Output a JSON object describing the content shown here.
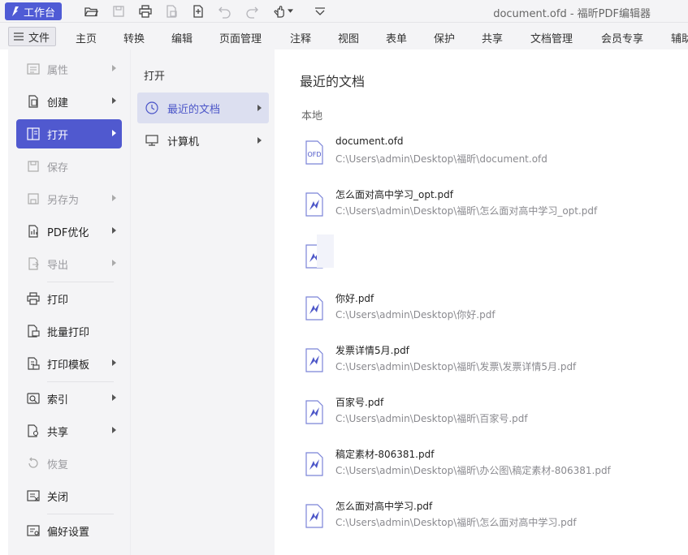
{
  "titlebar": {
    "app_label": "工作台",
    "window_title": "document.ofd - 福昕PDF编辑器"
  },
  "menubar": {
    "file_label": "文件",
    "tabs": [
      "主页",
      "转换",
      "编辑",
      "页面管理",
      "注释",
      "视图",
      "表单",
      "保护",
      "共享",
      "文档管理",
      "会员专享",
      "辅助"
    ]
  },
  "left_menu": {
    "items": [
      {
        "label": "属性",
        "state": "disabled",
        "icon": "properties-icon",
        "has_arrow": true
      },
      {
        "label": "创建",
        "state": "normal",
        "icon": "create-icon",
        "has_arrow": true
      },
      {
        "label": "打开",
        "state": "active",
        "icon": "open-icon",
        "has_arrow": true
      },
      {
        "label": "保存",
        "state": "disabled",
        "icon": "save-icon",
        "has_arrow": false
      },
      {
        "label": "另存为",
        "state": "disabled",
        "icon": "save-as-icon",
        "has_arrow": true
      },
      {
        "label": "PDF优化",
        "state": "normal",
        "icon": "pdf-optimize-icon",
        "has_arrow": true
      },
      {
        "label": "导出",
        "state": "disabled",
        "icon": "export-icon",
        "has_arrow": true
      },
      {
        "label": "打印",
        "state": "normal",
        "icon": "print-icon",
        "has_arrow": false
      },
      {
        "label": "批量打印",
        "state": "normal",
        "icon": "batch-print-icon",
        "has_arrow": false
      },
      {
        "label": "打印模板",
        "state": "normal",
        "icon": "print-template-icon",
        "has_arrow": true
      },
      {
        "label": "索引",
        "state": "normal",
        "icon": "index-icon",
        "has_arrow": true
      },
      {
        "label": "共享",
        "state": "normal",
        "icon": "share-icon",
        "has_arrow": true
      },
      {
        "label": "恢复",
        "state": "disabled",
        "icon": "restore-icon",
        "has_arrow": false
      },
      {
        "label": "关闭",
        "state": "normal",
        "icon": "close-doc-icon",
        "has_arrow": false
      },
      {
        "label": "偏好设置",
        "state": "normal",
        "icon": "preferences-icon",
        "has_arrow": false
      }
    ]
  },
  "open_menu": {
    "title": "打开",
    "items": [
      {
        "label": "最近的文档",
        "selected": true,
        "icon": "clock-icon"
      },
      {
        "label": "计算机",
        "selected": false,
        "icon": "computer-icon"
      }
    ]
  },
  "recent": {
    "title": "最近的文档",
    "section_label": "本地",
    "docs": [
      {
        "name": "document.ofd",
        "path": "C:\\Users\\admin\\Desktop\\福昕\\document.ofd",
        "type": "ofd"
      },
      {
        "name": "怎么面对高中学习_opt.pdf",
        "path": "C:\\Users\\admin\\Desktop\\福昕\\怎么面对高中学习_opt.pdf",
        "type": "pdf"
      },
      {
        "name": "",
        "path": "",
        "type": "pdf"
      },
      {
        "name": "你好.pdf",
        "path": "C:\\Users\\admin\\Desktop\\你好.pdf",
        "type": "pdf"
      },
      {
        "name": "发票详情5月.pdf",
        "path": "C:\\Users\\admin\\Desktop\\福昕\\发票\\发票详情5月.pdf",
        "type": "pdf"
      },
      {
        "name": "百家号.pdf",
        "path": "C:\\Users\\admin\\Desktop\\福昕\\百家号.pdf",
        "type": "pdf"
      },
      {
        "name": "稿定素材-806381.pdf",
        "path": "C:\\Users\\admin\\Desktop\\福昕\\办公图\\稿定素材-806381.pdf",
        "type": "pdf"
      },
      {
        "name": "怎么面对高中学习.pdf",
        "path": "C:\\Users\\admin\\Desktop\\福昕\\怎么面对高中学习.pdf",
        "type": "pdf"
      }
    ]
  },
  "colors": {
    "accent": "#5059cf",
    "panel_bg": "#f4f4f6",
    "selected_bg": "#dcdff0",
    "disabled_text": "#9a9a9f"
  }
}
